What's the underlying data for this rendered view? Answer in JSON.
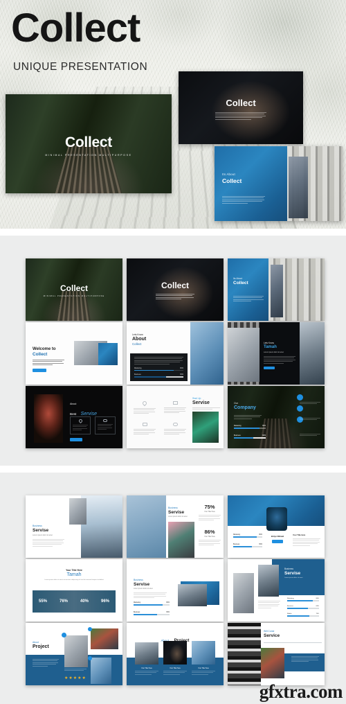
{
  "hero": {
    "title": "Collect",
    "subtitle": "UNIQUE PRESENTATION",
    "slides": [
      {
        "name": "main-title-slide",
        "title": "Collect",
        "tagline": "MINIMAL PRESENTATION MULTIPURPOSE"
      },
      {
        "name": "dark-title-slide",
        "title": "Collect",
        "body": "Lorem ipsum dolor sit amet consectetur adipiscing elit sed do eiusmod tempor incididunt ut labore et dolore magna aliqua"
      },
      {
        "name": "about-slide",
        "kicker": "Its About",
        "title": "Collect",
        "body": "Lorem ipsum dolor sit amet consectetur adipiscing elit sed do eiusmod tempor"
      }
    ]
  },
  "accent_colors": {
    "brand_blue": "#1b6fb0",
    "button_blue": "#1e8fe0",
    "deep_blue": "#17517f",
    "panel_blue": "#1f5f8f",
    "star_gold": "#f0b429",
    "dark_panel": "#121417",
    "page_bg": "#eceded"
  },
  "grid_one": {
    "name": "slide-grid-dark-blue",
    "slides": [
      {
        "id": "s1",
        "kind": "photo-title",
        "title": "Collect",
        "tagline": "MINIMAL PRESENTATION MULTIPURPOSE"
      },
      {
        "id": "s2",
        "kind": "photo-title",
        "title": "Collect",
        "body": "Lorem ipsum dolor sit amet consectetur"
      },
      {
        "id": "s3",
        "kind": "split-blue",
        "kicker": "Its About",
        "title": "Collect"
      },
      {
        "id": "s4",
        "kind": "light-welcome",
        "kicker": "Welcome to",
        "title": "Collect",
        "button": "Read More"
      },
      {
        "id": "s5",
        "kind": "about-stats",
        "kicker": "Lets Know",
        "title": "About",
        "subtitle": "Collect",
        "bars": [
          {
            "label": "Marketing",
            "value": "80%"
          },
          {
            "label": "Business",
            "value": "65%"
          }
        ]
      },
      {
        "id": "s6",
        "kind": "dark-person",
        "kicker": "Lets Know",
        "title": "Tamah",
        "subtitle": "Lorem ipsum dolor sit amet",
        "button": "Read More"
      },
      {
        "id": "s7",
        "kind": "dark-service",
        "kicker": "About",
        "title_light": "Best",
        "title_script": "Servise",
        "button": "Read More",
        "cards": [
          {
            "icon": "heart-icon"
          },
          {
            "icon": "cloud-icon"
          }
        ]
      },
      {
        "id": "s8",
        "kind": "light-service",
        "kicker": "Start Up",
        "title": "Servise",
        "features": [
          {
            "icon": "heart-icon"
          },
          {
            "icon": "monitor-icon"
          },
          {
            "icon": "camera-icon"
          },
          {
            "icon": "cloud-icon"
          }
        ]
      },
      {
        "id": "s9",
        "kind": "company-photo",
        "kicker": "Our",
        "title": "Company",
        "bars": [
          {
            "label": "Marketing",
            "value": "80%"
          },
          {
            "label": "Business",
            "value": "60%"
          }
        ],
        "badges": [
          "check-icon",
          "globe-icon",
          "gear-icon"
        ]
      }
    ]
  },
  "grid_two": {
    "name": "slide-grid-blue-white",
    "slides": [
      {
        "id": "t1",
        "kind": "business-photos",
        "kicker": "Business",
        "title": "Servise",
        "subtitle": "Lorem ipsum dolor sit amet"
      },
      {
        "id": "t2",
        "kind": "stats-two",
        "kicker": "Business",
        "title": "Servise",
        "subtitle": "Lorem ipsum dolor sit amet",
        "stats": [
          {
            "value": "75%",
            "label": "Your Title Here"
          },
          {
            "value": "86%",
            "label": "Your Title Here"
          }
        ]
      },
      {
        "id": "t3",
        "kind": "profile-card",
        "title": "Brilyn Rithald",
        "label": "Your Title Here",
        "button": "Read More",
        "bars": [
          {
            "label": "Marketing",
            "value": "80%"
          },
          {
            "label": "Business",
            "value": "65%"
          }
        ]
      },
      {
        "id": "t4",
        "kind": "percent-band",
        "kicker": "Your Title Here",
        "title": "Tamah",
        "subtitle": "Lorem ipsum dolor sit amet consectetur adipiscing elit sed do eiusmod tempor incididunt",
        "percents": [
          "55%",
          "76%",
          "40%",
          "96%"
        ]
      },
      {
        "id": "t5",
        "kind": "service-bars",
        "kicker": "Business",
        "title": "Servise",
        "subtitle": "Lorem ipsum dolor sit amet",
        "bars": [
          {
            "label": "Marketing",
            "value": "80%"
          },
          {
            "label": "Business",
            "value": "65%"
          }
        ]
      },
      {
        "id": "t6",
        "kind": "blue-panel-bars",
        "kicker": "Business",
        "title": "Servise",
        "subtitle": "Lorem ipsum dolor sit amet",
        "bars": [
          {
            "label": "Marketing",
            "value": "80%"
          },
          {
            "label": "Business",
            "value": "65%"
          },
          {
            "label": "Mobile",
            "value": "70%"
          }
        ]
      },
      {
        "id": "t7",
        "kind": "project-rating",
        "kicker": "About",
        "title": "Project",
        "stars": 5
      },
      {
        "id": "t8",
        "kind": "project-three",
        "kicker": "About",
        "title": "Project",
        "cards": [
          {
            "label": "Your Title Here"
          },
          {
            "label": "Your Title Here"
          },
          {
            "label": "Your Title Here"
          }
        ]
      },
      {
        "id": "t9",
        "kind": "willcome",
        "kicker": "Will Come",
        "title": "Service",
        "body": "Lorem ipsum dolor sit amet consectetur"
      }
    ]
  },
  "footer": {
    "watermark": "gfxtra.com"
  }
}
